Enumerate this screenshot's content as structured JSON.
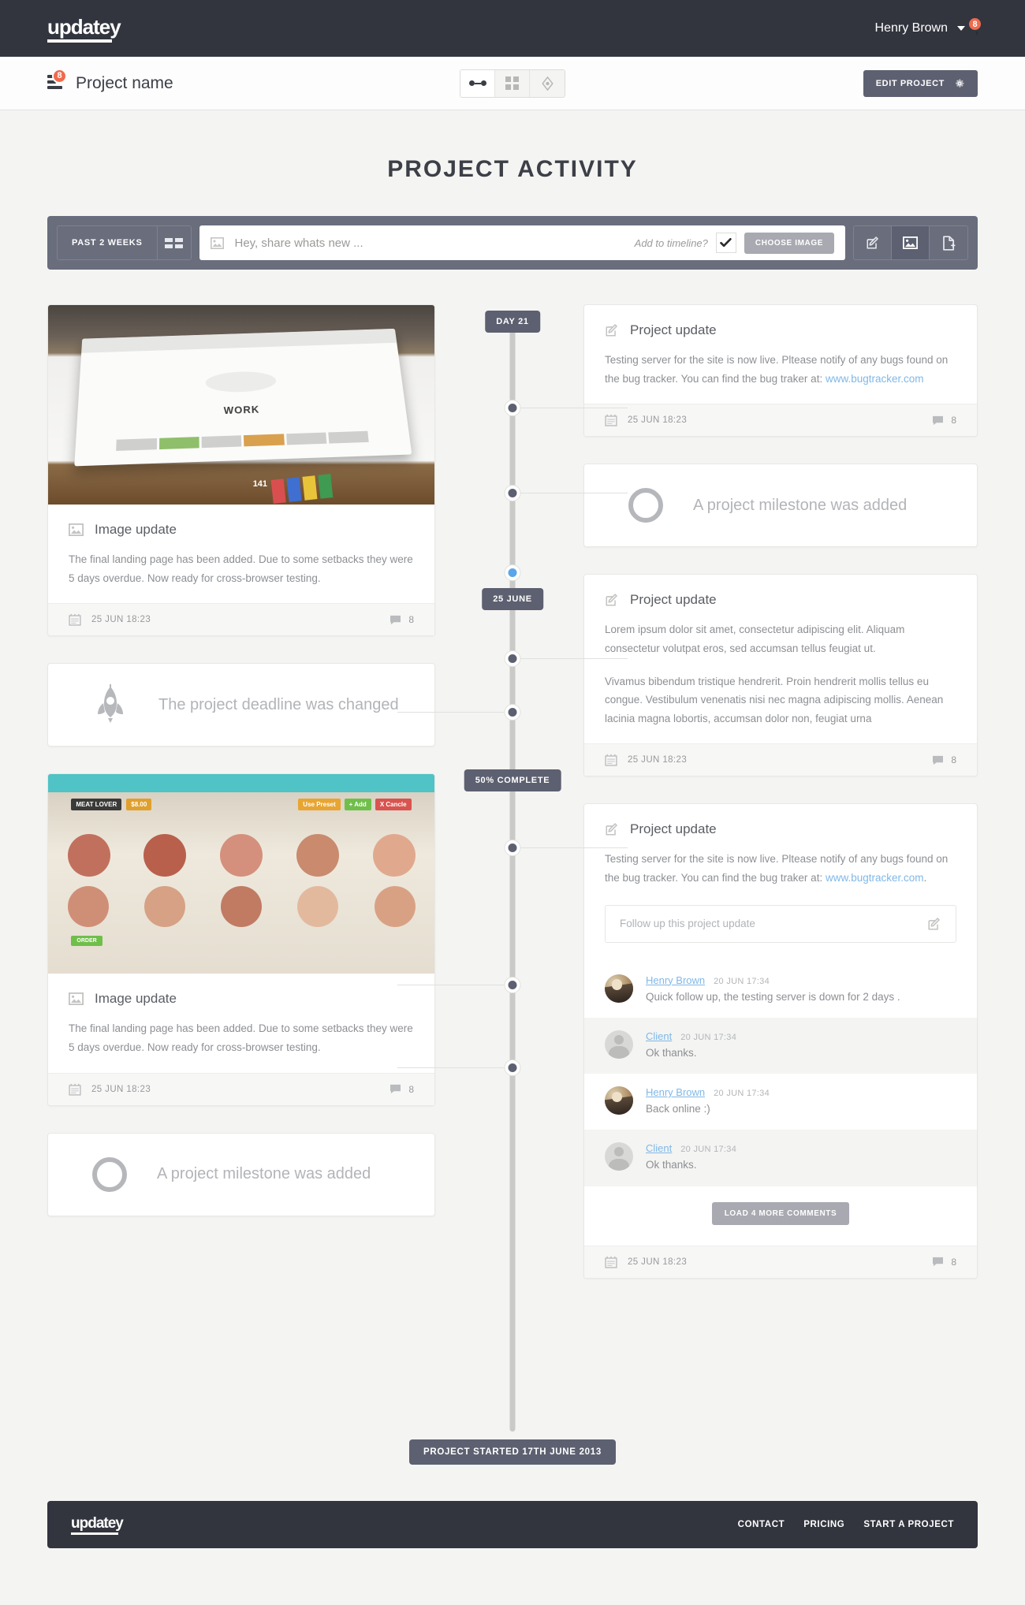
{
  "topnav": {
    "logo": "updatey",
    "username": "Henry Brown",
    "notification_count": "8"
  },
  "subheader": {
    "project_title": "Project name",
    "project_badge": "8",
    "view_toggle": [
      {
        "name": "timeline-view",
        "icon": "dumbbell-icon",
        "active": true
      },
      {
        "name": "grid-view",
        "icon": "grid-icon",
        "active": false
      },
      {
        "name": "milestone-view",
        "icon": "diamond-icon",
        "active": false
      }
    ],
    "edit_project_label": "EDIT PROJECT"
  },
  "page": {
    "title": "PROJECT ACTIVITY"
  },
  "composer": {
    "range_label": "PAST 2 WEEKS",
    "placeholder": "Hey, share whats new ...",
    "add_to_timeline_label": "Add to timeline?",
    "checkbox_checked": true,
    "choose_image_label": "CHOOSE IMAGE",
    "actions": [
      {
        "name": "text-update-button",
        "icon": "compose-icon",
        "active": false
      },
      {
        "name": "image-update-button",
        "icon": "image-icon",
        "active": true
      },
      {
        "name": "file-update-button",
        "icon": "file-add-icon",
        "active": false
      }
    ]
  },
  "timeline": {
    "stamps": [
      {
        "label": "DAY 21"
      },
      {
        "label": "25 JUNE"
      },
      {
        "label": "50% COMPLETE"
      }
    ],
    "bottom_stamp": "PROJECT STARTED 17TH JUNE 2013",
    "left_column": [
      {
        "type": "image-update",
        "icon": "image-icon",
        "title": "Image update",
        "text": "The final landing page has been added. Due to some setbacks they were 5 days overdue. Now ready for cross-browser testing.",
        "date": "25 JUN  18:23",
        "comment_count": "8"
      },
      {
        "type": "event",
        "icon": "rocket-icon",
        "label": "The project deadline was changed"
      },
      {
        "type": "image-update",
        "icon": "image-icon",
        "title": "Image update",
        "text": "The final landing page has been added. Due to some setbacks they were 5 days overdue. Now ready for cross-browser testing.",
        "date": "25 JUN  18:23",
        "comment_count": "8"
      },
      {
        "type": "event",
        "icon": "ring-icon",
        "label": "A project milestone was added"
      }
    ],
    "right_column": [
      {
        "type": "project-update",
        "icon": "compose-icon",
        "title": "Project update",
        "text_before_link": "Testing server for the site is now live. Pltease notify of any bugs found on the bug tracker. You can find the bug traker at: ",
        "link_text": "www.bugtracker.com",
        "text_after_link": "",
        "date": "25 JUN  18:23",
        "comment_count": "8"
      },
      {
        "type": "event",
        "icon": "ring-icon",
        "label": "A project milestone was added"
      },
      {
        "type": "project-update",
        "icon": "compose-icon",
        "title": "Project update",
        "paragraph1": "Lorem ipsum dolor sit amet, consectetur adipiscing elit. Aliquam consectetur volutpat eros, sed accumsan tellus feugiat ut.",
        "paragraph2": "Vivamus bibendum tristique hendrerit. Proin hendrerit mollis tellus eu congue. Vestibulum venenatis nisi nec magna adipiscing mollis. Aenean lacinia magna lobortis, accumsan dolor non, feugiat urna",
        "date": "25 JUN  18:23",
        "comment_count": "8"
      },
      {
        "type": "project-update-with-comments",
        "icon": "compose-icon",
        "title": "Project update",
        "text_before_link": "Testing server for the site is now live. Pltease notify of any bugs found on the bug tracker. You can find the bug traker at: ",
        "link_text": "www.bugtracker.com",
        "text_after_link": ".",
        "followup_placeholder": "Follow up this project update",
        "comments": [
          {
            "avatar": "henry",
            "name": "Henry Brown",
            "time": "20 JUN  17:34",
            "text": "Quick follow up, the testing server is down for 2 days ."
          },
          {
            "avatar": "client",
            "name": "Client",
            "time": "20 JUN  17:34",
            "text": "Ok thanks."
          },
          {
            "avatar": "henry",
            "name": "Henry Brown",
            "time": "20 JUN  17:34",
            "text": "Back online :)"
          },
          {
            "avatar": "client",
            "name": "Client",
            "time": "20 JUN  17:34",
            "text": "Ok thanks."
          }
        ],
        "load_more_label": "LOAD 4 MORE COMMENTS",
        "date": "25 JUN  18:23",
        "comment_count": "8"
      }
    ]
  },
  "footer": {
    "logo": "updatey",
    "links": [
      "CONTACT",
      "PRICING",
      "START A PROJECT"
    ]
  },
  "colors": {
    "dark": "#32353e",
    "slate": "#5d6070",
    "composer_bg": "#696d7c",
    "accent_orange": "#ef6b4e",
    "link_blue": "#7fb8e8",
    "active_dot_blue": "#5ba6e8",
    "page_bg": "#f4f4f2"
  }
}
